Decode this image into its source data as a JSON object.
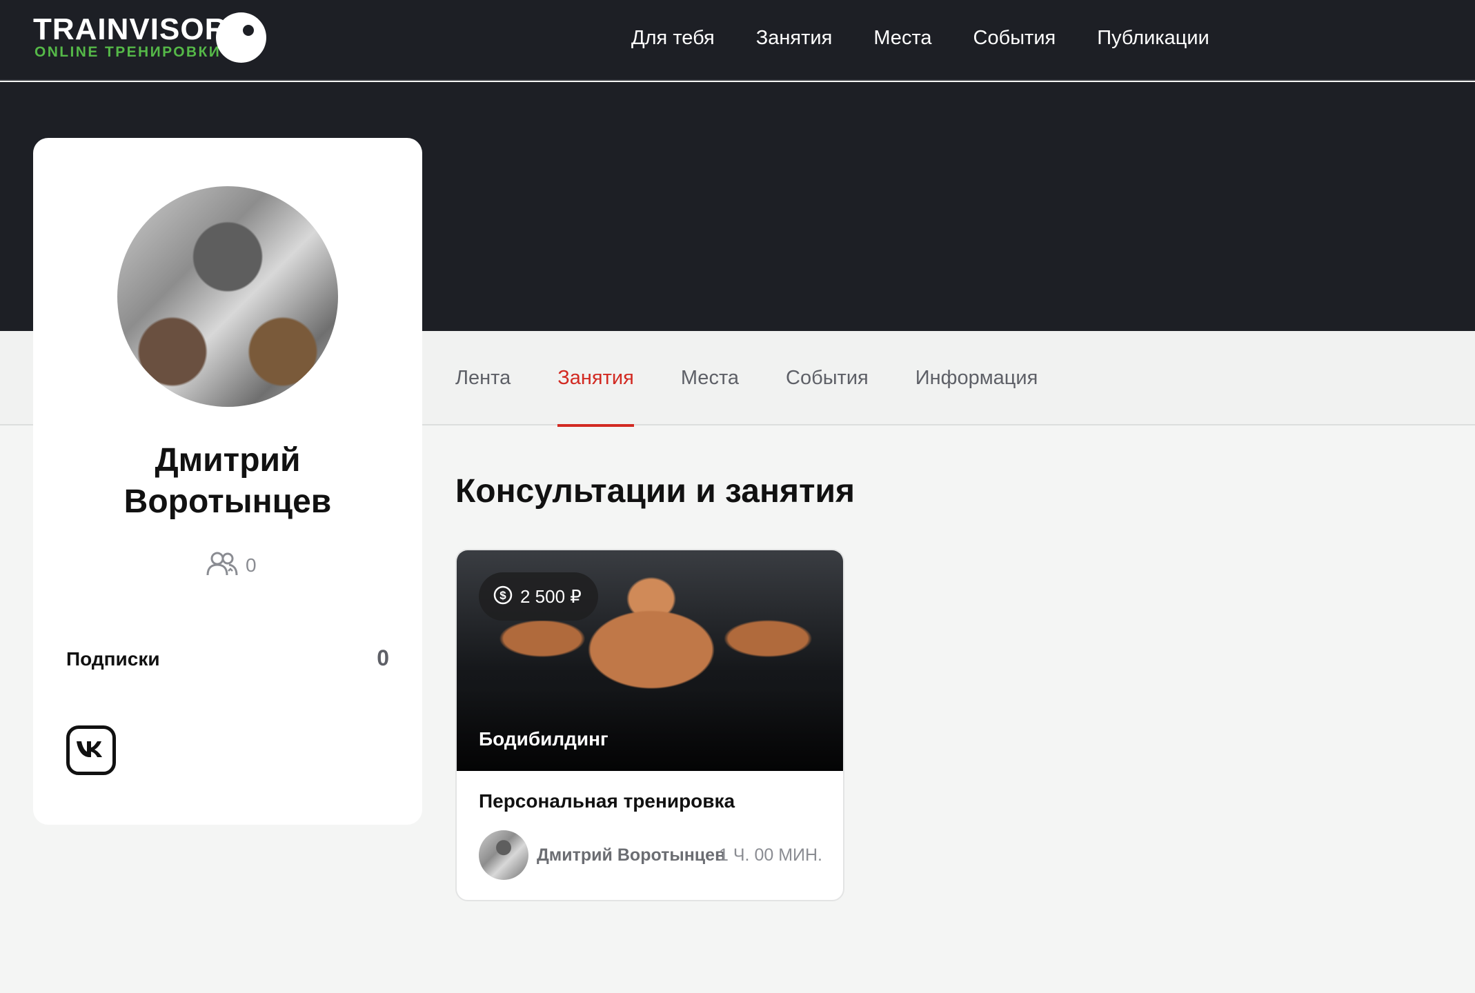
{
  "header": {
    "logo_title": "TRAINVISOR",
    "logo_subtitle": "ONLINE ТРЕНИРОВКИ",
    "nav": [
      {
        "label": "Для тебя"
      },
      {
        "label": "Занятия"
      },
      {
        "label": "Места"
      },
      {
        "label": "События"
      },
      {
        "label": "Публикации"
      }
    ]
  },
  "profile": {
    "first_name": "Дмитрий",
    "last_name": "Воротынцев",
    "followers_count": "0",
    "subscriptions_label": "Подписки",
    "subscriptions_count": "0",
    "social_icon": "vk-icon"
  },
  "tabs": [
    {
      "label": "Лента",
      "active": false
    },
    {
      "label": "Занятия",
      "active": true
    },
    {
      "label": "Места",
      "active": false
    },
    {
      "label": "События",
      "active": false
    },
    {
      "label": "Информация",
      "active": false
    }
  ],
  "main": {
    "section_title": "Консультации и занятия",
    "classes": [
      {
        "price": "2 500 ₽",
        "category": "Бодибилдинг",
        "title": "Персональная тренировка",
        "author": "Дмитрий Воротынцев",
        "duration": "1 Ч. 00 МИН."
      }
    ]
  },
  "colors": {
    "header_bg": "#1d1f25",
    "accent": "#d22a22",
    "logo_green": "#55b848"
  }
}
